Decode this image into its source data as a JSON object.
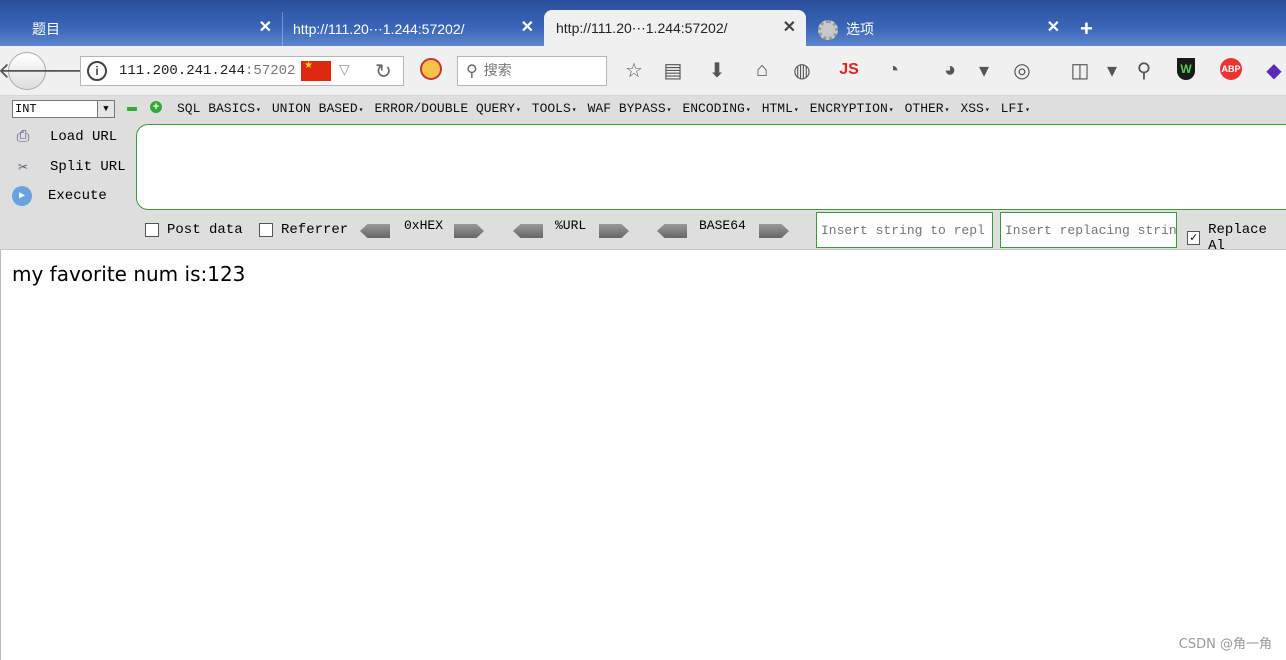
{
  "tabs": [
    {
      "label": "题目"
    },
    {
      "label": "http://111.20⋯1.244:57202/"
    },
    {
      "label": "http://111.20⋯1.244:57202/"
    },
    {
      "label": "选项"
    }
  ],
  "navbar": {
    "url_host": "111.200.241.244",
    "url_port": ":57202",
    "search_placeholder": "搜索",
    "js_label": "JS",
    "abp_label": "ABP",
    "shield_label": "W"
  },
  "hackbar": {
    "select_value": "INT",
    "menus": [
      "SQL BASICS",
      "UNION BASED",
      "ERROR/DOUBLE QUERY",
      "TOOLS",
      "WAF BYPASS",
      "ENCODING",
      "HTML",
      "ENCRYPTION",
      "OTHER",
      "XSS",
      "LFI"
    ],
    "load_url": "Load URL",
    "split_url": "Split URL",
    "execute": "Execute",
    "post_data": "Post data",
    "referrer": "Referrer",
    "hex": "0xHEX",
    "url": "%URL",
    "base64": "BASE64",
    "replace_from_placeholder": "Insert string to repl",
    "replace_to_placeholder": "Insert replacing strin",
    "replace_all": "Replace Al"
  },
  "page": {
    "text": "my favorite num is:123",
    "watermark": "CSDN @角一角"
  }
}
